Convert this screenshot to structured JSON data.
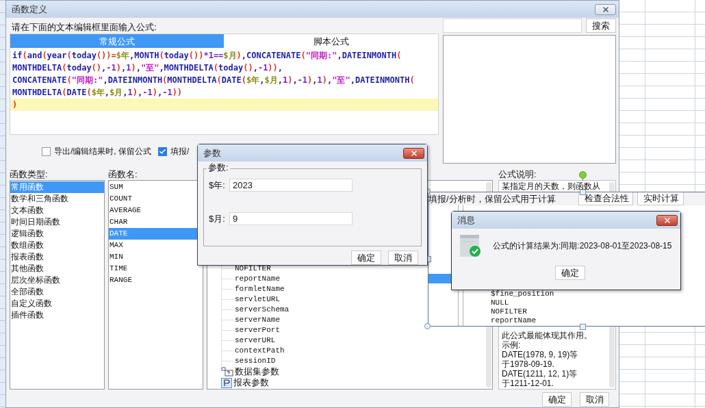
{
  "main_dialog": {
    "title": "函数定义",
    "prompt": "请在下面的文本编辑框里面输入公式:",
    "editor_tabs": [
      {
        "label": "常规公式",
        "selected": true
      },
      {
        "label": "脚本公式",
        "selected": false
      }
    ],
    "code_lines": [
      {
        "current": false,
        "tokens": [
          {
            "kind": "fn",
            "text": "if"
          },
          {
            "kind": "paren",
            "text": "("
          },
          {
            "kind": "fn",
            "text": "and"
          },
          {
            "kind": "paren",
            "text": "("
          },
          {
            "kind": "fn",
            "text": "year"
          },
          {
            "kind": "paren",
            "text": "("
          },
          {
            "kind": "fn",
            "text": "today"
          },
          {
            "kind": "paren",
            "text": "())"
          },
          {
            "kind": "paren",
            "text": "="
          },
          {
            "kind": "var",
            "text": "$年"
          },
          {
            "kind": "fn",
            "text": ",MONTH"
          },
          {
            "kind": "paren",
            "text": "("
          },
          {
            "kind": "fn",
            "text": "today"
          },
          {
            "kind": "paren",
            "text": "())"
          },
          {
            "kind": "num",
            "text": "*1=="
          },
          {
            "kind": "var",
            "text": "$月"
          },
          {
            "kind": "paren",
            "text": ")"
          },
          {
            "kind": "fn",
            "text": ",CONCATENATE"
          },
          {
            "kind": "paren",
            "text": "("
          },
          {
            "kind": "str",
            "text": "\"同期:\""
          },
          {
            "kind": "fn",
            "text": ",DATEINMONTH"
          },
          {
            "kind": "paren",
            "text": "("
          }
        ]
      },
      {
        "current": false,
        "tokens": [
          {
            "kind": "fn",
            "text": "MONTHDELTA"
          },
          {
            "kind": "paren",
            "text": "("
          },
          {
            "kind": "fn",
            "text": "today"
          },
          {
            "kind": "paren",
            "text": "()"
          },
          {
            "kind": "fn",
            "text": ","
          },
          {
            "kind": "num",
            "text": "-1"
          },
          {
            "kind": "paren",
            "text": ")"
          },
          {
            "kind": "fn",
            "text": ","
          },
          {
            "kind": "num",
            "text": "1"
          },
          {
            "kind": "paren",
            "text": ")"
          },
          {
            "kind": "fn",
            "text": ","
          },
          {
            "kind": "str",
            "text": "\"至\""
          },
          {
            "kind": "fn",
            "text": ",MONTHDELTA"
          },
          {
            "kind": "paren",
            "text": "("
          },
          {
            "kind": "fn",
            "text": "today"
          },
          {
            "kind": "paren",
            "text": "()"
          },
          {
            "kind": "fn",
            "text": ","
          },
          {
            "kind": "num",
            "text": "-1"
          },
          {
            "kind": "paren",
            "text": "))"
          },
          {
            "kind": "fn",
            "text": ","
          }
        ]
      },
      {
        "current": false,
        "tokens": [
          {
            "kind": "fn",
            "text": "CONCATENATE"
          },
          {
            "kind": "paren",
            "text": "("
          },
          {
            "kind": "str",
            "text": "\"同期:\""
          },
          {
            "kind": "fn",
            "text": ",DATEINMONTH"
          },
          {
            "kind": "paren",
            "text": "("
          },
          {
            "kind": "fn",
            "text": "MONTHDELTA"
          },
          {
            "kind": "paren",
            "text": "("
          },
          {
            "kind": "fn",
            "text": "DATE"
          },
          {
            "kind": "paren",
            "text": "("
          },
          {
            "kind": "var",
            "text": "$年"
          },
          {
            "kind": "fn",
            "text": ","
          },
          {
            "kind": "var",
            "text": "$月"
          },
          {
            "kind": "fn",
            "text": ","
          },
          {
            "kind": "num",
            "text": "1"
          },
          {
            "kind": "paren",
            "text": ")"
          },
          {
            "kind": "fn",
            "text": ","
          },
          {
            "kind": "num",
            "text": "-1"
          },
          {
            "kind": "paren",
            "text": ")"
          },
          {
            "kind": "fn",
            "text": ","
          },
          {
            "kind": "num",
            "text": "1"
          },
          {
            "kind": "paren",
            "text": ")"
          },
          {
            "kind": "fn",
            "text": ","
          },
          {
            "kind": "str",
            "text": "\"至\""
          },
          {
            "kind": "fn",
            "text": ",DATEINMONTH"
          },
          {
            "kind": "paren",
            "text": "("
          }
        ]
      },
      {
        "current": false,
        "tokens": [
          {
            "kind": "fn",
            "text": "MONTHDELTA"
          },
          {
            "kind": "paren",
            "text": "("
          },
          {
            "kind": "fn",
            "text": "DATE"
          },
          {
            "kind": "paren",
            "text": "("
          },
          {
            "kind": "var",
            "text": "$年"
          },
          {
            "kind": "fn",
            "text": ","
          },
          {
            "kind": "var",
            "text": "$月"
          },
          {
            "kind": "fn",
            "text": ","
          },
          {
            "kind": "num",
            "text": "1"
          },
          {
            "kind": "paren",
            "text": ")"
          },
          {
            "kind": "fn",
            "text": ","
          },
          {
            "kind": "num",
            "text": "-1"
          },
          {
            "kind": "paren",
            "text": ")"
          },
          {
            "kind": "fn",
            "text": ","
          },
          {
            "kind": "num",
            "text": "-1"
          },
          {
            "kind": "paren",
            "text": "))"
          }
        ]
      },
      {
        "current": true,
        "tokens": [
          {
            "kind": "paren",
            "text": ")"
          }
        ]
      }
    ],
    "search_button": "搜索",
    "options": [
      {
        "label": "导出/编辑结果时, 保留公式",
        "checked": false
      },
      {
        "label": "填报/",
        "checked": true
      }
    ],
    "function_types": {
      "label": "函数类型:",
      "items": [
        {
          "text": "常用函数",
          "selected": true
        },
        {
          "text": "数学和三角函数",
          "selected": false
        },
        {
          "text": "文本函数",
          "selected": false
        },
        {
          "text": "时间日期函数",
          "selected": false
        },
        {
          "text": "逻辑函数",
          "selected": false
        },
        {
          "text": "数组函数",
          "selected": false
        },
        {
          "text": "报表函数",
          "selected": false
        },
        {
          "text": "其他函数",
          "selected": false
        },
        {
          "text": "层次坐标函数",
          "selected": false
        },
        {
          "text": "全部函数",
          "selected": false
        },
        {
          "text": "自定义函数",
          "selected": false
        },
        {
          "text": "插件函数",
          "selected": false
        }
      ]
    },
    "function_names": {
      "label": "函数名:",
      "items": [
        {
          "text": "SUM",
          "selected": false
        },
        {
          "text": "COUNT",
          "selected": false
        },
        {
          "text": "AVERAGE",
          "selected": false
        },
        {
          "text": "CHAR",
          "selected": false
        },
        {
          "text": "DATE",
          "selected": true
        },
        {
          "text": "MAX",
          "selected": false
        },
        {
          "text": "MIN",
          "selected": false
        },
        {
          "text": "TIME",
          "selected": false
        },
        {
          "text": "RANGE",
          "selected": false
        }
      ]
    },
    "tree_nodes": [
      {
        "kind": "group",
        "children": [
          {
            "text": "NOFILTER"
          },
          {
            "text": "reportName"
          },
          {
            "text": "formletName"
          },
          {
            "text": "servletURL"
          },
          {
            "text": "serverSchema"
          },
          {
            "text": "serverName"
          },
          {
            "text": "serverPort"
          },
          {
            "text": "serverURL"
          },
          {
            "text": "contextPath"
          },
          {
            "text": "sessionID"
          }
        ]
      },
      {
        "kind": "dataset",
        "text": "数据集参数"
      },
      {
        "kind": "param",
        "text": "报表参数"
      }
    ],
    "description": {
      "label": "公式说明:",
      "top_line": "某指定月的天数，则函数从",
      "bottom_lines": [
        "此公式最能体现其作用。",
        "示例:",
        "DATE(1978, 9, 19)等",
        "于1978-09-19.",
        "DATE(1211, 12, 1)等",
        "于1211-12-01."
      ]
    },
    "buttons": [
      "确定",
      "取消"
    ]
  },
  "param_dialog": {
    "title": "参数",
    "group_label": "参数:",
    "fields": [
      {
        "label": "$年:",
        "value": "2023"
      },
      {
        "label": "$月:",
        "value": "9"
      }
    ],
    "buttons": [
      "确定",
      "取消"
    ]
  },
  "message_dialog": {
    "title": "消息",
    "message": "公式的计算结果为:同期:2023-08-01至2023-08-15",
    "button": "确定"
  },
  "capture_region": {
    "option_label": "填报/分析时，保留公式用于计算",
    "buttons": [
      "检查合法性",
      "实时计算"
    ],
    "tree_items": [
      "$fine_position",
      "NULL",
      "NOFILTER",
      "reportName"
    ]
  }
}
